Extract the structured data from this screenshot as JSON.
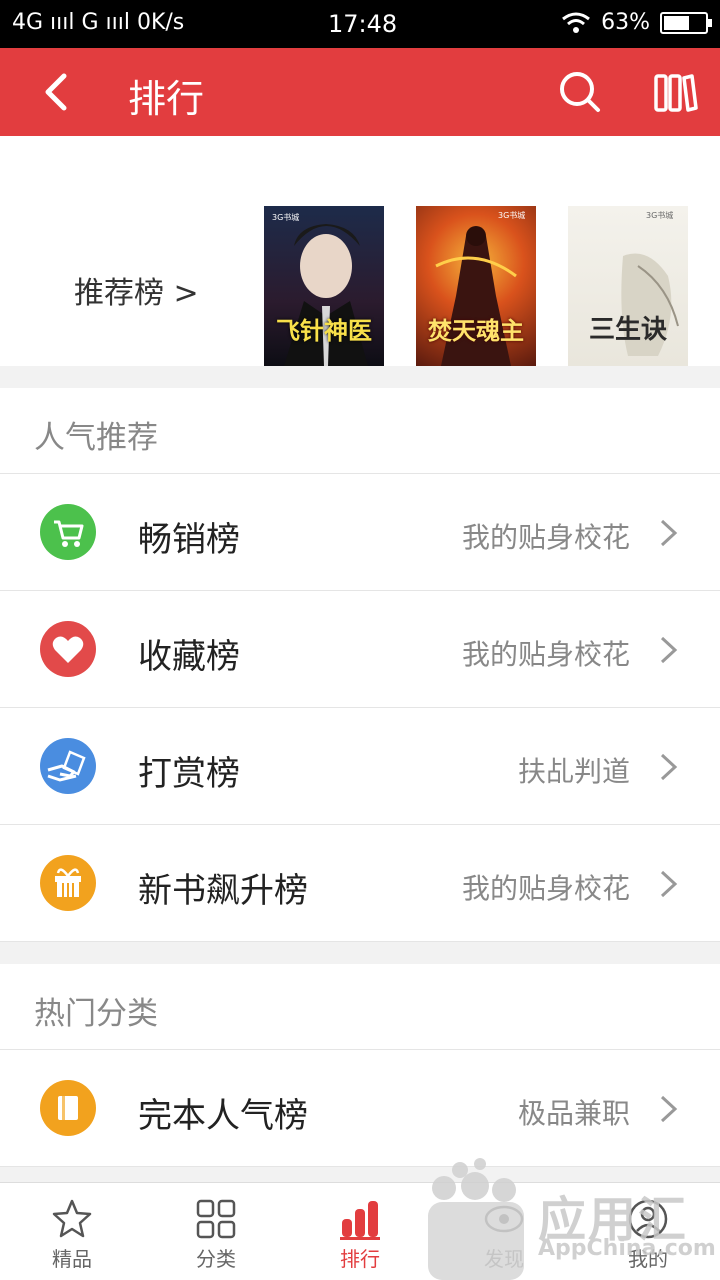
{
  "status_bar": {
    "left": "4G ıııl G ıııl 0K/s",
    "time": "17:48",
    "battery": "63%",
    "battery_level": 0.63
  },
  "header": {
    "title": "排行",
    "back_icon": "back-arrow-icon",
    "search_icon": "search-icon",
    "bookshelf_icon": "bookshelf-icon",
    "color": "#e23d3f"
  },
  "recommend": {
    "label": "推荐榜 >",
    "covers": [
      {
        "title": "飞针神医",
        "brand": "3G书城"
      },
      {
        "title": "焚天魂主",
        "brand": "3G书城"
      },
      {
        "title": "三生诀",
        "brand": "3G书城"
      }
    ]
  },
  "popular": {
    "heading": "人气推荐",
    "rows": [
      {
        "name": "畅销榜",
        "sub": "我的贴身校花",
        "icon": "cart-icon",
        "color": "#4cc14c"
      },
      {
        "name": "收藏榜",
        "sub": "我的贴身校花",
        "icon": "heart-icon",
        "color": "#e24a4a"
      },
      {
        "name": "打赏榜",
        "sub": "扶乩判道",
        "icon": "hand-money-icon",
        "color": "#4a8de0"
      },
      {
        "name": "新书飙升榜",
        "sub": "我的贴身校花",
        "icon": "gift-icon",
        "color": "#f2a21e"
      }
    ]
  },
  "hot": {
    "heading": "热门分类",
    "rows": [
      {
        "name": "完本人气榜",
        "sub": "极品兼职",
        "icon": "book-icon",
        "color": "#f2a21e"
      }
    ]
  },
  "bottom_nav": [
    {
      "label": "精品",
      "icon": "star-icon"
    },
    {
      "label": "分类",
      "icon": "grid-icon"
    },
    {
      "label": "排行",
      "icon": "bar-chart-icon",
      "active": true
    },
    {
      "label": "发现",
      "icon": "discover-icon"
    },
    {
      "label": "我的",
      "icon": "user-icon"
    }
  ],
  "watermark": {
    "text": "应用汇",
    "sub": "AppChina.com"
  }
}
